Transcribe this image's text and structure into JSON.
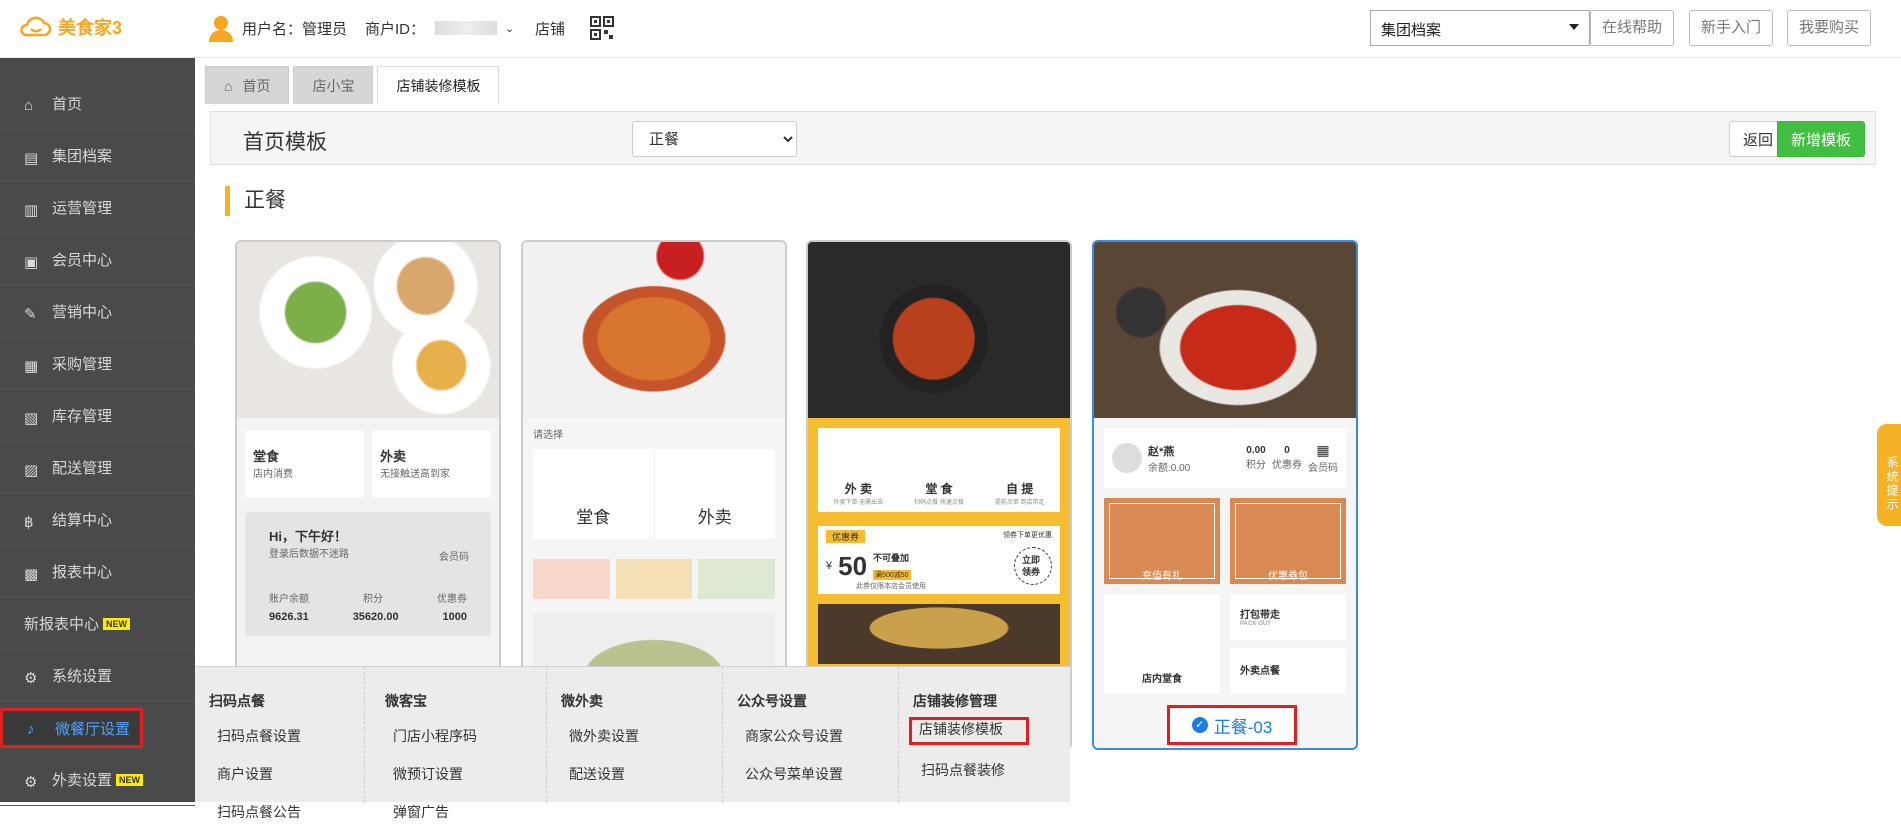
{
  "app": {
    "logo_text": "美食家3"
  },
  "header": {
    "username_label": "用户名：管理员",
    "merchant_label": "商户ID：",
    "shop_label": "店铺",
    "group_select": "集团档案",
    "help_btn": "在线帮助",
    "guide_btn": "新手入门",
    "buy_btn": "我要购买"
  },
  "sidebar": {
    "items": [
      {
        "label": "首页",
        "icon": "home-icon"
      },
      {
        "label": "集团档案",
        "icon": "file-icon"
      },
      {
        "label": "运营管理",
        "icon": "chart-icon"
      },
      {
        "label": "会员中心",
        "icon": "idcard-icon"
      },
      {
        "label": "营销中心",
        "icon": "edit-icon"
      },
      {
        "label": "采购管理",
        "icon": "book-icon"
      },
      {
        "label": "库存管理",
        "icon": "doc-icon"
      },
      {
        "label": "配送管理",
        "icon": "truck-icon"
      },
      {
        "label": "结算中心",
        "icon": "bitcoin-icon"
      },
      {
        "label": "报表中心",
        "icon": "report-icon"
      },
      {
        "label": "新报表中心",
        "badge": "NEW"
      },
      {
        "label": "系统设置",
        "icon": "gears-icon"
      },
      {
        "label": "微餐厅设置",
        "icon": "cutlery-icon"
      },
      {
        "label": "外卖设置",
        "icon": "gear-icon",
        "badge": "NEW"
      }
    ]
  },
  "tabs": [
    {
      "label": "首页"
    },
    {
      "label": "店小宝"
    },
    {
      "label": "店铺装修模板"
    }
  ],
  "page": {
    "title": "首页模板",
    "category_select": "正餐",
    "back_btn": "返回",
    "add_btn": "新增模板",
    "section_title": "正餐"
  },
  "cards": {
    "c1": {
      "dine": "堂食",
      "dine_sub": "店内消费",
      "take": "外卖",
      "take_sub": "无接触送高到家",
      "greet": "Hi，下午好！",
      "greet_sub": "登录后数据不迷路",
      "qr_label": "会员码",
      "balance_label": "账户余额",
      "points_label": "积分",
      "coupon_label": "优惠券",
      "balance": "9626.31",
      "points": "35620.00",
      "coupons": "1000"
    },
    "c2": {
      "hint": "请选择",
      "dine": "堂食",
      "take": "外卖"
    },
    "c3": {
      "take": "外 卖",
      "take_sub": "外卖下单 无需出去",
      "dine": "堂 食",
      "dine_sub": "扫码点餐 快速点餐",
      "pick": "自 提",
      "pick_sub": "提前点单 到店带走",
      "coupon_tag": "优惠券",
      "coupon_hint": "领券下单更优惠",
      "amount": "50",
      "cond": "不可叠加",
      "cond_tag": "满500减50",
      "scope": "此券仅限本店会员使用",
      "grab": "立即领券"
    },
    "c4": {
      "name": "赵*燕",
      "balance": "余额:0.00",
      "points_val": "0.00",
      "coupon_val": "0",
      "points": "积分",
      "coupons": "优惠券",
      "member_code": "会员码",
      "recharge": "充值有礼",
      "coupon_pkg": "优惠券包",
      "dine": "店内堂食",
      "pack": "打包带走",
      "pack_sub": "PACK OUT",
      "deliver": "外卖点餐"
    }
  },
  "selected_template": "正餐-03",
  "submenu": {
    "cols": [
      {
        "head": "扫码点餐",
        "items": [
          "扫码点餐设置",
          "商户设置",
          "扫码点餐公告"
        ]
      },
      {
        "head": "微客宝",
        "items": [
          "门店小程序码",
          "微预订设置",
          "弹窗广告"
        ]
      },
      {
        "head": "微外卖",
        "items": [
          "微外卖设置",
          "配送设置"
        ]
      },
      {
        "head": "公众号设置",
        "items": [
          "商家公众号设置",
          "公众号菜单设置"
        ]
      },
      {
        "head": "店铺装修管理",
        "items": [
          "店铺装修模板",
          "扫码点餐装修"
        ]
      }
    ]
  },
  "system_tip": "系统提示",
  "colors": {
    "accent": "#f5b227",
    "primary": "#1e7de0",
    "green": "#42bf42",
    "sidebar": "#4a4a4a",
    "highlight": "#e02020"
  }
}
